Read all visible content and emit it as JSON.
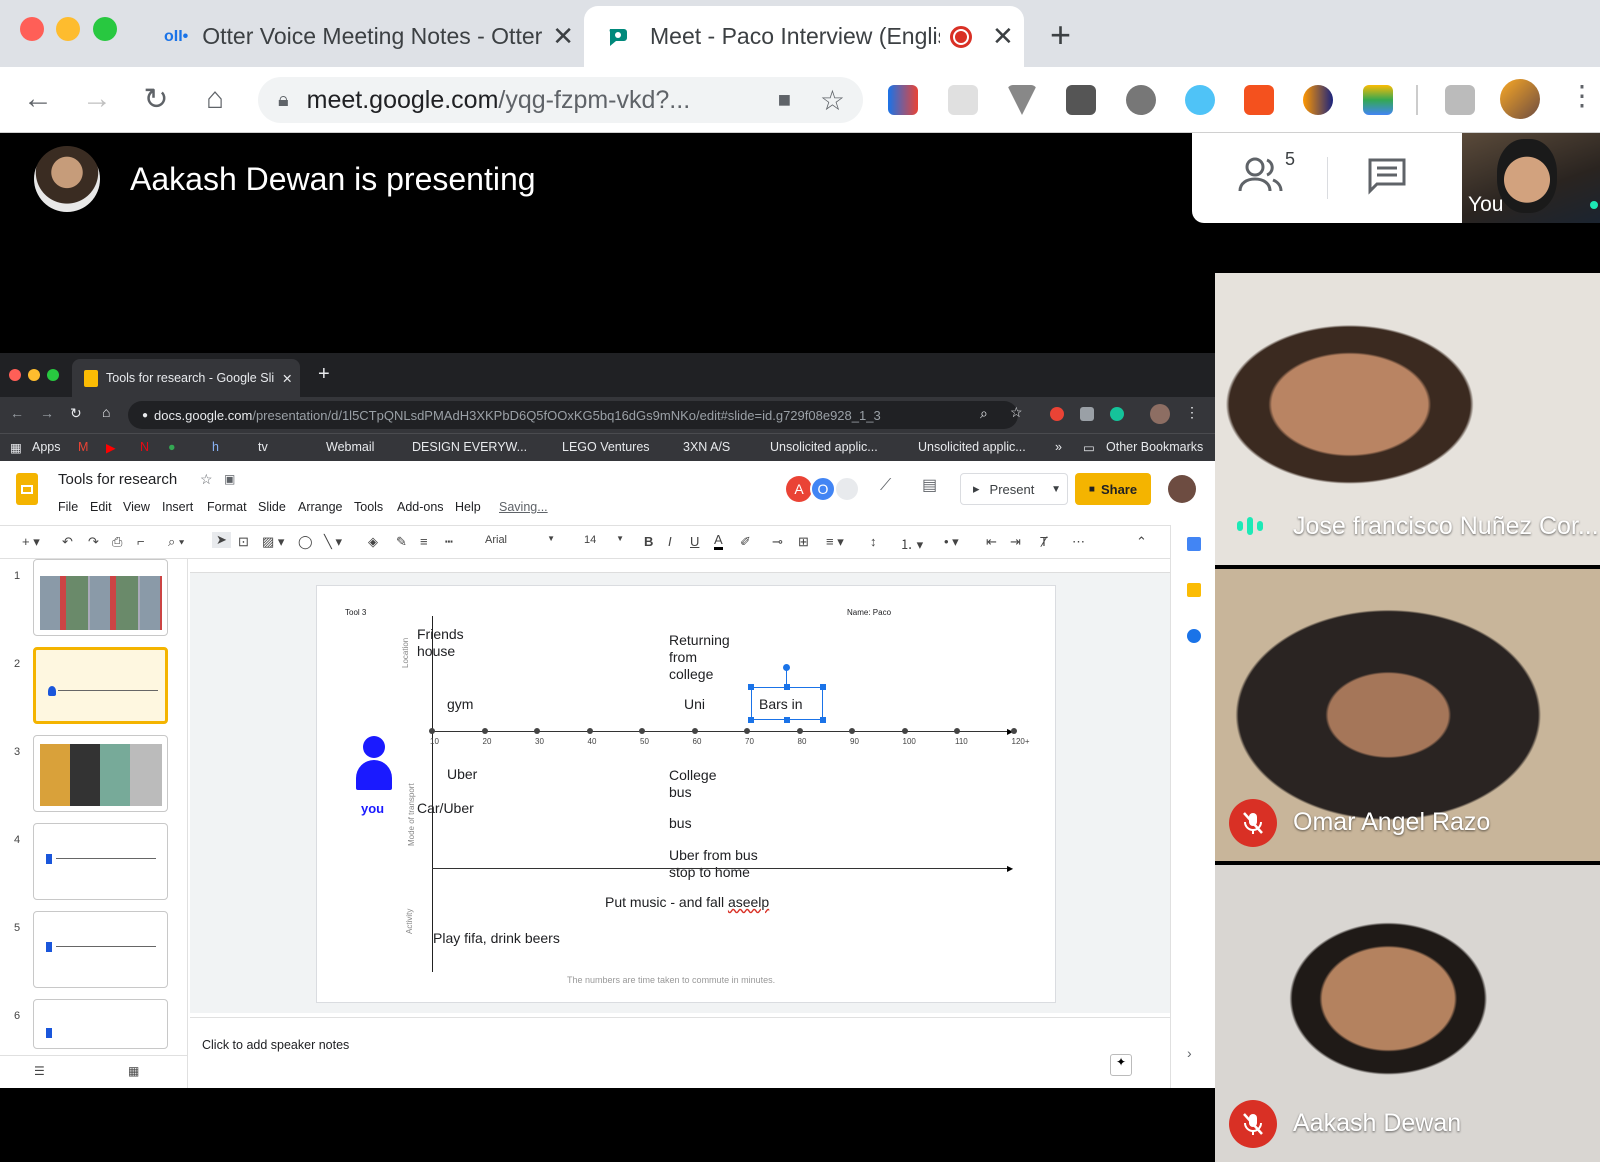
{
  "browser": {
    "tabs": [
      {
        "label": "Otter Voice Meeting Notes - Otter",
        "active": false
      },
      {
        "label": "Meet - Paco Interview (English",
        "active": true
      }
    ],
    "url_host": "meet.google.com",
    "url_path": "/yqg-fzpm-vkd?..."
  },
  "meet": {
    "presenting_text": "Aakash Dewan is presenting",
    "participant_count": "5",
    "self_label": "You",
    "participants": [
      {
        "name": "Jose francisco Nuñez Cor...",
        "muted": false
      },
      {
        "name": "Omar Angel Razo",
        "muted": true
      },
      {
        "name": "Aakash Dewan",
        "muted": true
      }
    ]
  },
  "shared": {
    "tab_title": "Tools for research - Google Sli",
    "url_host": "docs.google.com",
    "url_path": "/presentation/d/1l5CTpQNLsdPMAdH3XKPbD6Q5fOOxKG5bq16dGs9mNKo/edit#slide=id.g729f08e928_1_3",
    "bookmarks": [
      "Apps",
      "Webmail",
      "DESIGN EVERYW...",
      "LEGO Ventures",
      "3XN A/S",
      "Unsolicited applic...",
      "Unsolicited applic...",
      "»",
      "Other Bookmarks"
    ],
    "doc_title": "Tools for research",
    "menus": [
      "File",
      "Edit",
      "View",
      "Insert",
      "Format",
      "Slide",
      "Arrange",
      "Tools",
      "Add-ons",
      "Help"
    ],
    "saving": "Saving...",
    "collab_initials": [
      "A",
      "O"
    ],
    "present_label": "Present",
    "share_label": "Share",
    "font_name": "Arial",
    "font_size": "14",
    "slide_numbers": [
      "1",
      "2",
      "3",
      "4",
      "5",
      "6"
    ],
    "notes_placeholder": "Click to add speaker notes",
    "slide": {
      "tool_label": "Tool 3",
      "name_label": "Name: Paco",
      "location_label": "Location",
      "transport_label": "Mode of transport",
      "activity_label": "Activity",
      "you_label": "you",
      "friends_house": "Friends house",
      "returning": "Returning from college",
      "gym": "gym",
      "uni": "Uni",
      "bars": "Bars in",
      "uber": "Uber",
      "car_uber": "Car/Uber",
      "college_bus": "College bus",
      "bus": "bus",
      "uber_from_bus": "Uber from bus stop to home",
      "put_music_prefix": "Put music - and fall ",
      "put_music_err": "aseelp",
      "play_fifa": "Play fifa, drink beers",
      "footnote": "The numbers are time taken to commute in minutes.",
      "axis_ticks": [
        "10",
        "20",
        "30",
        "40",
        "50",
        "60",
        "70",
        "80",
        "90",
        "100",
        "110",
        "120+"
      ]
    }
  }
}
